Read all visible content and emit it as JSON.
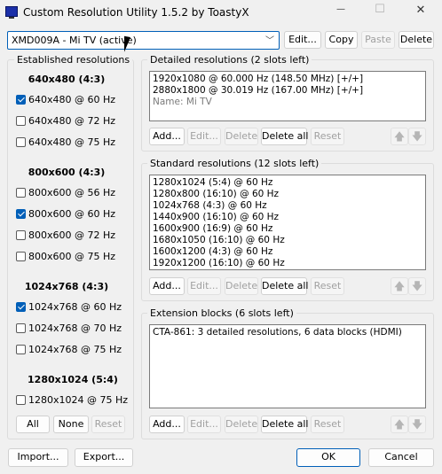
{
  "window": {
    "title": "Custom Resolution Utility 1.5.2 by ToastyX"
  },
  "titlebar": {
    "minimize": "—",
    "maximize": "☐",
    "close": "✕"
  },
  "display_select": {
    "value": "XMD009A - Mi TV (active)"
  },
  "top_buttons": {
    "edit": "Edit...",
    "copy": "Copy",
    "paste": "Paste",
    "delete": "Delete"
  },
  "established": {
    "label": "Established resolutions",
    "groups": [
      {
        "heading": "640x480 (4:3)",
        "items": [
          {
            "label": "640x480 @ 60 Hz",
            "checked": true
          },
          {
            "label": "640x480 @ 72 Hz",
            "checked": false
          },
          {
            "label": "640x480 @ 75 Hz",
            "checked": false
          }
        ]
      },
      {
        "heading": "800x600 (4:3)",
        "items": [
          {
            "label": "800x600 @ 56 Hz",
            "checked": false
          },
          {
            "label": "800x600 @ 60 Hz",
            "checked": true
          },
          {
            "label": "800x600 @ 72 Hz",
            "checked": false
          },
          {
            "label": "800x600 @ 75 Hz",
            "checked": false
          }
        ]
      },
      {
        "heading": "1024x768 (4:3)",
        "items": [
          {
            "label": "1024x768 @ 60 Hz",
            "checked": true
          },
          {
            "label": "1024x768 @ 70 Hz",
            "checked": false
          },
          {
            "label": "1024x768 @ 75 Hz",
            "checked": false
          }
        ]
      },
      {
        "heading": "1280x1024 (5:4)",
        "items": [
          {
            "label": "1280x1024 @ 75 Hz",
            "checked": false
          }
        ]
      }
    ],
    "buttons": {
      "all": "All",
      "none": "None",
      "reset": "Reset"
    }
  },
  "detailed": {
    "label": "Detailed resolutions (2 slots left)",
    "items": [
      "1920x1080 @ 60.000 Hz (148.50 MHz) [+/+]",
      "2880x1800 @ 30.019 Hz (167.00 MHz) [+/+]"
    ],
    "name_line": "Name: Mi TV",
    "buttons": {
      "add": "Add...",
      "edit": "Edit...",
      "delete": "Delete",
      "delete_all": "Delete all",
      "reset": "Reset"
    }
  },
  "standard": {
    "label": "Standard resolutions (12 slots left)",
    "items": [
      "1280x1024 (5:4) @ 60 Hz",
      "1280x800 (16:10) @ 60 Hz",
      "1024x768 (4:3) @ 60 Hz",
      "1440x900 (16:10) @ 60 Hz",
      "1600x900 (16:9) @ 60 Hz",
      "1680x1050 (16:10) @ 60 Hz",
      "1600x1200 (4:3) @ 60 Hz",
      "1920x1200 (16:10) @ 60 Hz"
    ],
    "buttons": {
      "add": "Add...",
      "edit": "Edit...",
      "delete": "Delete",
      "delete_all": "Delete all",
      "reset": "Reset"
    }
  },
  "extension": {
    "label": "Extension blocks (6 slots left)",
    "items": [
      "CTA-861: 3 detailed resolutions, 6 data blocks (HDMI)"
    ],
    "buttons": {
      "add": "Add...",
      "edit": "Edit...",
      "delete": "Delete",
      "delete_all": "Delete all",
      "reset": "Reset"
    }
  },
  "bottom_buttons": {
    "import": "Import...",
    "export": "Export...",
    "ok": "OK",
    "cancel": "Cancel"
  },
  "arrows": {
    "up": "🡅",
    "down": "🡇"
  },
  "colors": {
    "accent": "#005fb8",
    "title_icon": "#1b2fa8"
  }
}
